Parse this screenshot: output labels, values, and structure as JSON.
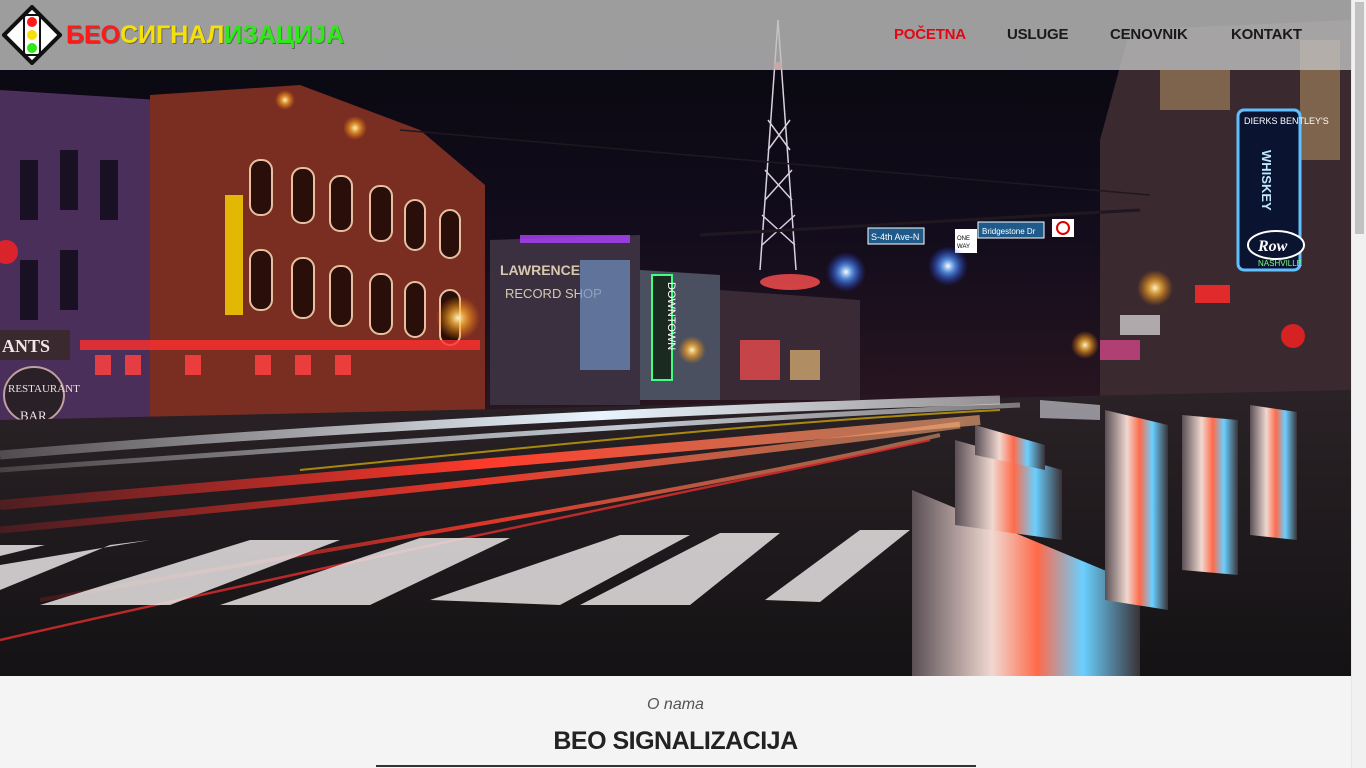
{
  "logo": {
    "segments": [
      {
        "text": "БЕО",
        "color": "#ff1a1a"
      },
      {
        "text": "СИГНАЛ",
        "color": "#f4e00a"
      },
      {
        "text": "ИЗАЦИЈА",
        "color": "#2ee81a"
      }
    ],
    "icon": "traffic-light-icon"
  },
  "nav": {
    "items": [
      {
        "label": "POČETNA",
        "active": true
      },
      {
        "label": "USLUGE",
        "active": false
      },
      {
        "label": "CENOVNIK",
        "active": false
      },
      {
        "label": "KONTAKT",
        "active": false
      }
    ],
    "active_color": "#e30613"
  },
  "hero": {
    "street_signs": [
      "S-4th Ave-N",
      "ONE WAY",
      "Bridgestone Dr"
    ],
    "building_signs": [
      "WHISKEY",
      "Row",
      "NASHVILLE",
      "RESTAURANT",
      "BAR",
      "ANTS",
      "LAWRENCE",
      "RECORD SHOP",
      "DOWNTOWN",
      "DIERKS BENTLEY'S"
    ]
  },
  "about": {
    "subtitle": "O nama",
    "title": "BEO SIGNALIZACIJA"
  }
}
